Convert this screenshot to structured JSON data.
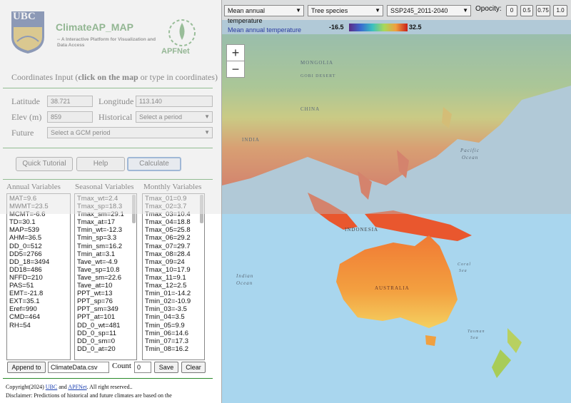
{
  "header": {
    "ubc_logo_text": "UBC",
    "app_title": "ClimateAP_MAP",
    "app_subtitle": "-- A Interactive Platform for Visualization and Data Access",
    "partner_logo_text": "APFNet"
  },
  "coords": {
    "title_prefix": "Coordinates Input (",
    "title_bold": "click on the map",
    "title_suffix": " or type in coordinates)",
    "latitude_label": "Latitude",
    "latitude_value": "38.721",
    "longitude_label": "Longitude",
    "longitude_value": "113.140",
    "elev_label": "Elev (m)",
    "elev_value": "859",
    "historical_label": "Historical",
    "historical_value": "Select a period",
    "future_label": "Future",
    "future_value": "Select a GCM period"
  },
  "buttons": {
    "tutorial": "Quick Tutorial",
    "help": "Help",
    "calculate": "Calculate"
  },
  "columns": {
    "annual_title": "Annual Variables",
    "seasonal_title": "Seasonal Variables",
    "monthly_title": "Monthly Variables",
    "annual": [
      "MAT=9.6",
      "MWMT=23.5",
      "MCMT=-6.6",
      "TD=30.1",
      "MAP=539",
      "AHM=36.5",
      "DD_0=512",
      "DD5=2766",
      "DD_18=3494",
      "DD18=486",
      "NFFD=210",
      "PAS=51",
      "EMT=-21.8",
      "EXT=35.1",
      "Eref=990",
      "CMD=464",
      "RH=54"
    ],
    "seasonal": [
      "Tmax_wt=2.4",
      "Tmax_sp=18.3",
      "Tmax_sm=29.1",
      "Tmax_at=17",
      "Tmin_wt=-12.3",
      "Tmin_sp=3.3",
      "Tmin_sm=16.2",
      "Tmin_at=3.1",
      "Tave_wt=-4.9",
      "Tave_sp=10.8",
      "Tave_sm=22.6",
      "Tave_at=10",
      "PPT_wt=13",
      "PPT_sp=76",
      "PPT_sm=349",
      "PPT_at=101",
      "DD_0_wt=481",
      "DD_0_sp=11",
      "DD_0_sm=0",
      "DD_0_at=20"
    ],
    "monthly": [
      "Tmax_01=0.9",
      "Tmax_02=3.7",
      "Tmax_03=10.4",
      "Tmax_04=18.8",
      "Tmax_05=25.8",
      "Tmax_06=29.2",
      "Tmax_07=29.7",
      "Tmax_08=28.4",
      "Tmax_09=24",
      "Tmax_10=17.9",
      "Tmax_11=9.1",
      "Tmax_12=2.5",
      "Tmin_01=-14.2",
      "Tmin_02=-10.9",
      "Tmin_03=-3.5",
      "Tmin_04=3.5",
      "Tmin_05=9.9",
      "Tmin_06=14.6",
      "Tmin_07=17.3",
      "Tmin_08=16.2"
    ]
  },
  "bottom": {
    "append_label": "Append to",
    "filename": "ClimateData.csv",
    "count_label": "Count",
    "count_value": "0",
    "save_label": "Save",
    "clear_label": "Clear"
  },
  "footer": {
    "copyright_prefix": "Copyright(2024)",
    "ubc_link": "UBC",
    "and": "and",
    "apfnet_link": "APFNet",
    "rights": ". All right reserved..",
    "disclaimer": "Disclaimer: Predictions of historical and future climates are based on the"
  },
  "map_controls": {
    "variable": "Mean annual temperature",
    "species": "Tree species",
    "scenario": "SSP245_2011-2040",
    "opacity_label": "Opocity:",
    "opacity_options": [
      "0",
      "0.5",
      "0.75",
      "1.0"
    ]
  },
  "legend": {
    "title": "Mean annual temperature",
    "min": "-16.5",
    "max": "32.5"
  },
  "map_labels": {
    "mongolia": "MONGOLIA",
    "gobi": "GOBI DESERT",
    "china": "CHINA",
    "india": "INDIA",
    "indonesia": "INDONESIA",
    "australia": "AUSTRALIA",
    "pacific": "Pacific",
    "pacific2": "Ocean",
    "indian": "Indian",
    "indian2": "Ocean",
    "coral": "Coral",
    "coral2": "Sea",
    "tasman": "Tasman",
    "tasman2": "Sea"
  },
  "zoom": {
    "in": "+",
    "out": "−"
  },
  "colors": {
    "accent_green": "#2a8a2a",
    "link_blue": "#1a3fb0",
    "calc_border": "#4a7fc0"
  }
}
